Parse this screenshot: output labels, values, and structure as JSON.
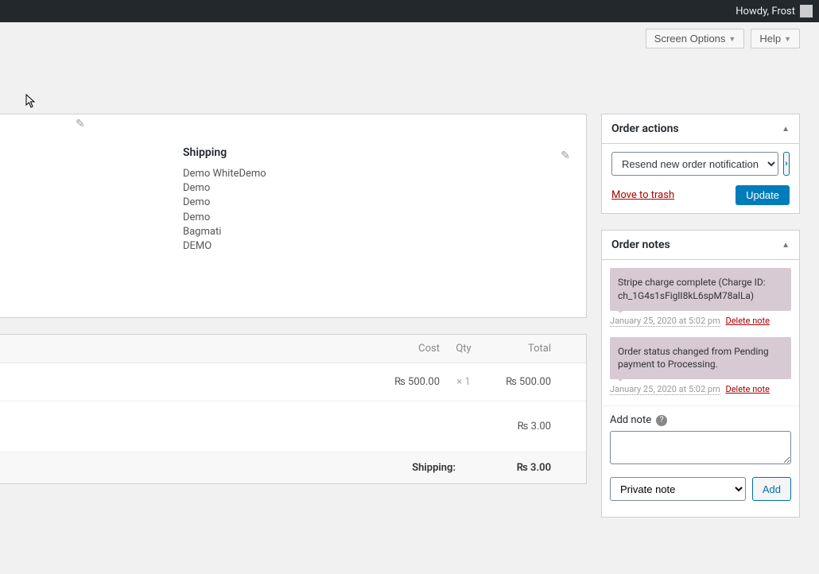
{
  "adminBar": {
    "greeting": "Howdy, Frost"
  },
  "topTabs": {
    "screenOptions": "Screen Options",
    "help": "Help"
  },
  "shipping": {
    "title": "Shipping",
    "lines": [
      "Demo WhiteDemo",
      "Demo",
      "Demo",
      "Demo",
      "Bagmati",
      "DEMO"
    ]
  },
  "items": {
    "headers": {
      "cost": "Cost",
      "qty": "Qty",
      "total": "Total"
    },
    "rows": [
      {
        "cost": "₨ 500.00",
        "qtyPrefix": "× ",
        "qty": "1",
        "total": "₨ 500.00"
      }
    ],
    "shippingRow": {
      "total": "₨ 3.00"
    },
    "summary": {
      "label": "Shipping:",
      "value": "₨ 3.00"
    }
  },
  "orderActions": {
    "title": "Order actions",
    "selectLabel": "Resend new order notification",
    "trash": "Move to trash",
    "update": "Update"
  },
  "orderNotes": {
    "title": "Order notes",
    "notes": [
      {
        "text": "Stripe charge complete (Charge ID: ch_1G4s1sFiglI8kL6spM78alLa)",
        "date": "January 25, 2020 at 5:02 pm",
        "del": "Delete note"
      },
      {
        "text": "Order status changed from Pending payment to Processing.",
        "date": "January 25, 2020 at 5:02 pm",
        "del": "Delete note"
      }
    ],
    "addLabel": "Add note",
    "noteType": "Private note",
    "addBtn": "Add"
  }
}
